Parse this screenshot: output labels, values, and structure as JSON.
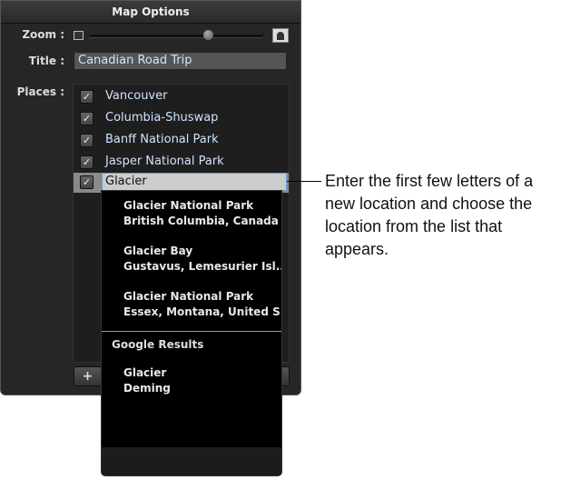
{
  "panel": {
    "title": "Map Options",
    "zoom_label": "Zoom :",
    "zoom_value": 0.68,
    "title_label": "Title :",
    "title_value": "Canadian Road Trip",
    "places_label": "Places :"
  },
  "places": [
    {
      "name": "Vancouver",
      "checked": true
    },
    {
      "name": "Columbia-Shuswap",
      "checked": true
    },
    {
      "name": "Banff National Park",
      "checked": true
    },
    {
      "name": "Jasper National Park",
      "checked": true
    },
    {
      "name": "Glacier",
      "checked": true
    }
  ],
  "check_glyph": "✓",
  "add_label": "+",
  "results": [
    {
      "name": "Glacier National Park",
      "detail": "British Columbia, Canada"
    },
    {
      "name": "Glacier Bay",
      "detail": "Gustavus, Lemesurier Isl..."
    },
    {
      "name": "Glacier National Park",
      "detail": "Essex, Montana, United S..."
    }
  ],
  "google": {
    "header": "Google Results",
    "results": [
      {
        "name": "Glacier",
        "detail": "Deming"
      }
    ]
  },
  "callout": "Enter the first few letters of a new location and choose the location from the list that appears."
}
